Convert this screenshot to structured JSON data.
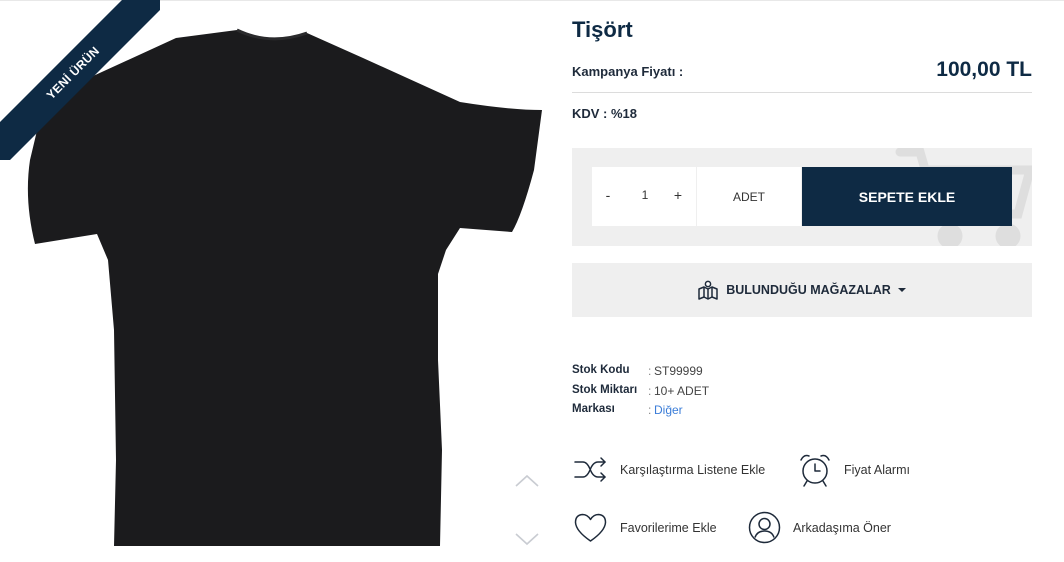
{
  "badge": {
    "new_label": "YENİ ÜRÜN"
  },
  "product": {
    "title": "Tişört",
    "price_label": "Kampanya Fiyatı :",
    "price_value": "100,00 TL",
    "kdv": "KDV : %18"
  },
  "cart": {
    "minus": "-",
    "plus": "+",
    "quantity": "1",
    "unit": "ADET",
    "add_label": "SEPETE EKLE"
  },
  "stores": {
    "label": "BULUNDUĞU MAĞAZALAR"
  },
  "specs": [
    {
      "key": "Stok Kodu",
      "sep": ":",
      "value": "ST99999"
    },
    {
      "key": "Stok Miktarı",
      "sep": ":",
      "value": "10+ ADET"
    },
    {
      "key": "Markası",
      "sep": ":",
      "value": "Diğer"
    }
  ],
  "actions": {
    "compare": "Karşılaştırma Listene Ekle",
    "price_alarm": "Fiyat Alarmı",
    "favorites": "Favorilerime Ekle",
    "recommend": "Arkadaşıma Öner"
  },
  "colors": {
    "brand": "#0e2a44",
    "panel": "#efefef",
    "link": "#3b7dd8",
    "shirt": "#1b1b1d"
  }
}
